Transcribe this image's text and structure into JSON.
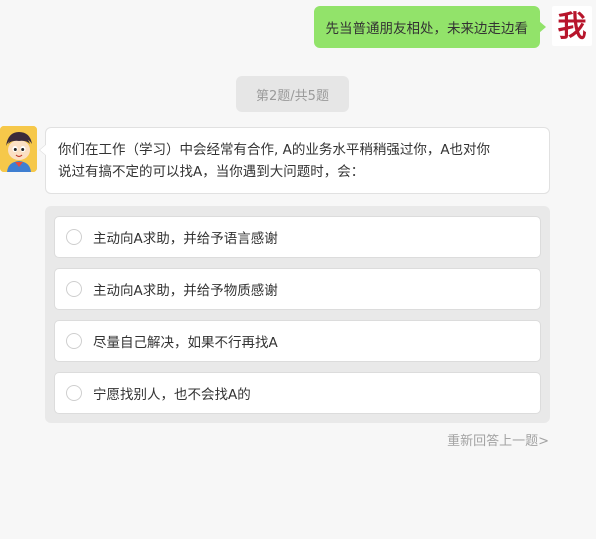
{
  "user_message": {
    "text": "先当普通朋友相处，未来边走边看",
    "avatar_text": "我"
  },
  "progress": {
    "label": "第2题/共5题"
  },
  "question": {
    "line1": "你们在工作（学习）中会经常有合作, A的业务水平稍稍强过你，A也对你",
    "line2": "说过有搞不定的可以找A，当你遇到大问题时，会："
  },
  "options": [
    {
      "label": "主动向A求助，并给予语言感谢"
    },
    {
      "label": "主动向A求助，并给予物质感谢"
    },
    {
      "label": "尽量自己解决，如果不行再找A"
    },
    {
      "label": "宁愿找别人，也不会找A的"
    }
  ],
  "redo_link": "重新回答上一题>",
  "colors": {
    "user_bubble": "#92e36a",
    "avatar_text": "#b7152b",
    "bot_avatar_bg": "#f6c84a",
    "background": "#f7f7f7"
  }
}
